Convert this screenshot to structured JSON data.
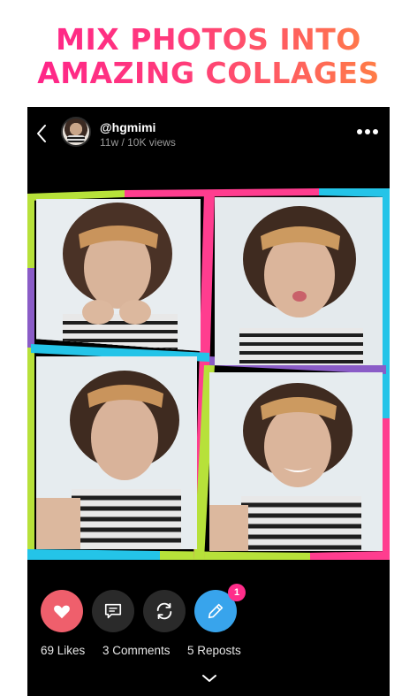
{
  "headline": {
    "line1": "MIX PHOTOS INTO",
    "line2": "AMAZING COLLAGES"
  },
  "post": {
    "username": "@hgmimi",
    "meta": "11w / 10K views"
  },
  "icons": {
    "back": "chevron-left-icon",
    "more": "more-dots-icon",
    "like": "heart-icon",
    "comment": "comment-icon",
    "repost": "repost-icon",
    "edit": "pencil-icon",
    "expand": "chevron-down-icon"
  },
  "actions": {
    "likes_label": "69 Likes",
    "comments_label": "3 Comments",
    "reposts_label": "5 Reposts",
    "edit_badge": "1"
  },
  "colors": {
    "headline_gradient": [
      "#ff1f8c",
      "#ff8a3c"
    ],
    "like": "#ef5f6c",
    "edit": "#38a4ec",
    "badge": "#ff2d8a",
    "collage_frames": [
      "#b7e13a",
      "#ff3d8f",
      "#24c4e8",
      "#8a5cc7"
    ]
  }
}
